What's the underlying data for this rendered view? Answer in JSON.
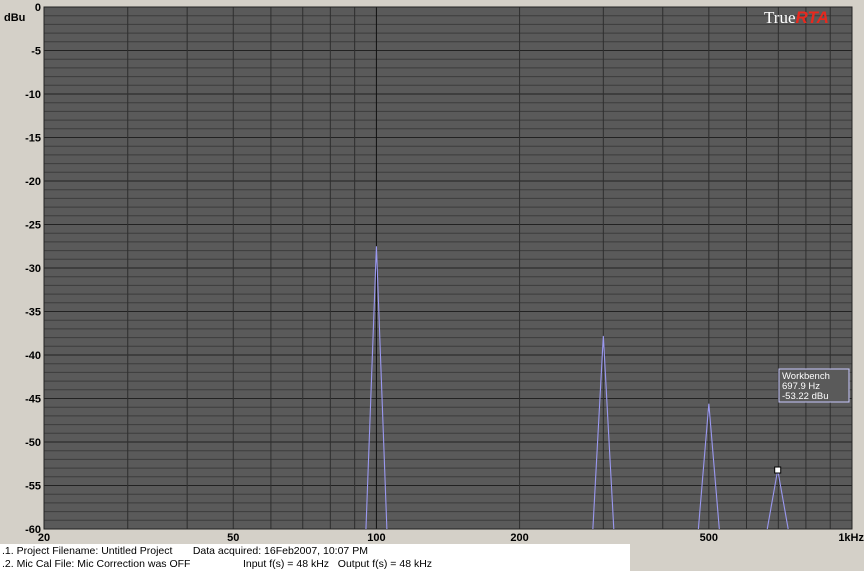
{
  "chart_data": {
    "type": "line",
    "title": "",
    "ylabel": "dBu",
    "xlabel": "",
    "xscale": "log",
    "xlim": [
      20,
      1000
    ],
    "ylim": [
      -60,
      0
    ],
    "grid": true,
    "x_ticks": [
      20,
      50,
      100,
      200,
      500,
      1000
    ],
    "x_tick_labels": [
      "20",
      "50",
      "100",
      "200",
      "500",
      "1kHz"
    ],
    "y_ticks": [
      0,
      -5,
      -10,
      -15,
      -20,
      -25,
      -30,
      -35,
      -40,
      -45,
      -50,
      -55,
      -60
    ],
    "y_tick_labels": [
      "0",
      "-5",
      "-10",
      "-15",
      "-20",
      "-25",
      "-30",
      "-35",
      "-40",
      "-45",
      "-50",
      "-55",
      "-60"
    ],
    "series": [
      {
        "color": "#9a98f0",
        "peaks": [
          {
            "x": 100,
            "y": -27.5
          },
          {
            "x": 300,
            "y": -37.8
          },
          {
            "x": 500,
            "y": -45.6
          },
          {
            "x": 697.9,
            "y": -53.2
          }
        ]
      }
    ],
    "cursor": {
      "x": 697.9,
      "y": -53.22
    },
    "cursor_readout": {
      "label": "Workbench",
      "freq": "697.9 Hz",
      "level": "-53.22 dBu"
    }
  },
  "branding": {
    "logo_text_1": "True",
    "logo_text_2": "RTA"
  },
  "colors": {
    "plot_bg": "#5a5a5a",
    "grid": "#2a2a2a",
    "trace": "#9a98f0",
    "logo_red": "#e8281e"
  },
  "footer": {
    "line1": ".1. Project Filename: Untitled Project       Data acquired: 16Feb2007, 10:07 PM",
    "line2": ".2. Mic Cal File: Mic Correction was OFF                  Input f(s) = 48 kHz   Output f(s) = 48 kHz"
  }
}
